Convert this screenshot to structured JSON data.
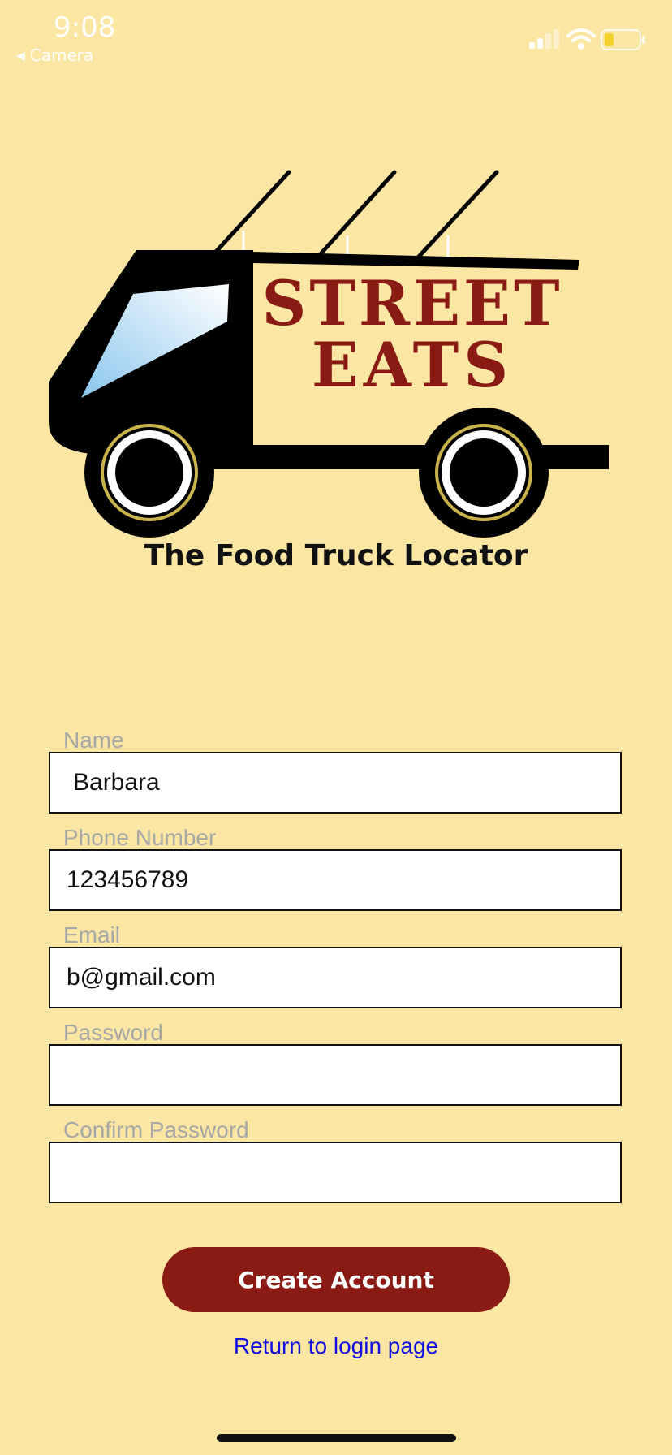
{
  "status_bar": {
    "time": "9:08",
    "back_app": "Camera",
    "icons": [
      "cellular-signal-icon",
      "wifi-icon",
      "battery-icon"
    ]
  },
  "logo": {
    "line1": "STREET",
    "line2": "EATS",
    "colors": {
      "brand_red": "#8a1a14",
      "truck_black": "#000000",
      "background": "#fbe6a4"
    }
  },
  "subtitle": "The Food Truck Locator",
  "form": {
    "name": {
      "label": "Name",
      "value": "Barbara"
    },
    "phone": {
      "label": "Phone Number",
      "value": "123456789"
    },
    "email": {
      "label": "Email",
      "value": "b@gmail.com"
    },
    "password": {
      "label": "Password",
      "value": ""
    },
    "confirm_password": {
      "label": "Confirm Password",
      "value": ""
    }
  },
  "actions": {
    "create_account": "Create Account",
    "return_login": "Return to login page"
  }
}
